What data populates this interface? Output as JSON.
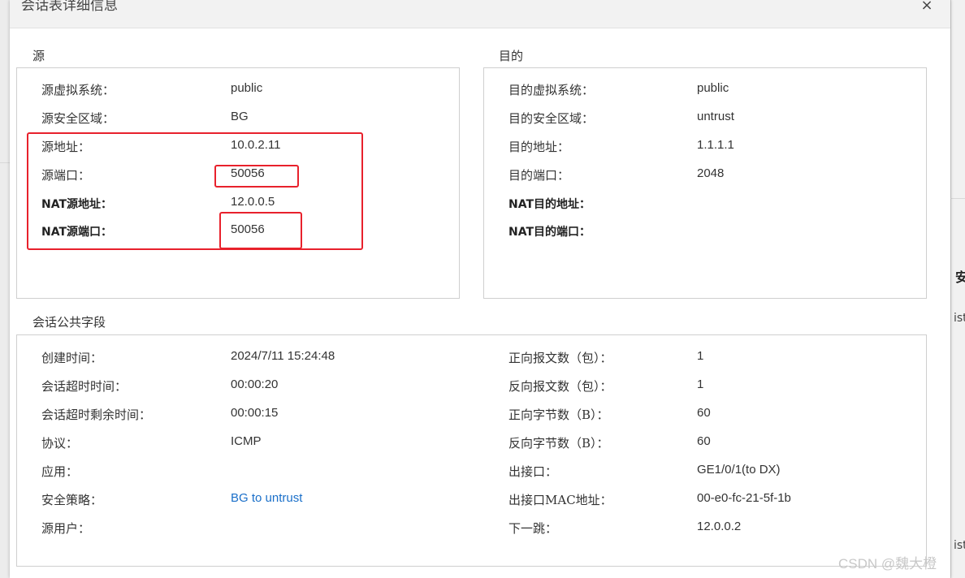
{
  "dialog": {
    "title": "会话表详细信息",
    "close_symbol": "×"
  },
  "source": {
    "title": "源",
    "rows": [
      {
        "label": "源虚拟系统：",
        "value": "public"
      },
      {
        "label": "源安全区域：",
        "value": "BG"
      },
      {
        "label": "源地址：",
        "value": "10.0.2.11"
      },
      {
        "label": "源端口：",
        "value": "50056"
      },
      {
        "label": "NAT源地址：",
        "value": "12.0.0.5"
      },
      {
        "label": "NAT源端口：",
        "value": "50056"
      }
    ]
  },
  "destination": {
    "title": "目的",
    "rows": [
      {
        "label": "目的虚拟系统：",
        "value": "public"
      },
      {
        "label": "目的安全区域：",
        "value": "untrust"
      },
      {
        "label": "目的地址：",
        "value": "1.1.1.1"
      },
      {
        "label": "目的端口：",
        "value": "2048"
      },
      {
        "label": "NAT目的地址：",
        "value": ""
      },
      {
        "label": "NAT目的端口：",
        "value": ""
      }
    ]
  },
  "common": {
    "title": "会话公共字段",
    "left_rows": [
      {
        "label": "创建时间：",
        "value": "2024/7/11 15:24:48"
      },
      {
        "label": "会话超时时间：",
        "value": "00:00:20"
      },
      {
        "label": "会话超时剩余时间：",
        "value": "00:00:15"
      },
      {
        "label": "协议：",
        "value": "ICMP"
      },
      {
        "label": "应用：",
        "value": ""
      },
      {
        "label": "安全策略：",
        "value": "BG to untrust"
      },
      {
        "label": "源用户：",
        "value": ""
      }
    ],
    "right_rows": [
      {
        "label": "正向报文数（包）：",
        "value": "1"
      },
      {
        "label": "反向报文数（包）：",
        "value": "1"
      },
      {
        "label": "正向字节数（B）：",
        "value": "60"
      },
      {
        "label": "反向字节数（B）：",
        "value": "60"
      },
      {
        "label": "出接口：",
        "value": "GE1/0/1(to DX)"
      },
      {
        "label": "出接口MAC地址：",
        "value": "00-e0-fc-21-5f-1b"
      },
      {
        "label": "下一跳：",
        "value": "12.0.0.2"
      }
    ]
  },
  "background": {
    "right_label": "安",
    "right_text_1": "ist",
    "right_text_2": "ist"
  },
  "watermark": "CSDN @魏大橙",
  "colors": {
    "highlight": "#e8212c",
    "link": "#1a6fc9"
  }
}
